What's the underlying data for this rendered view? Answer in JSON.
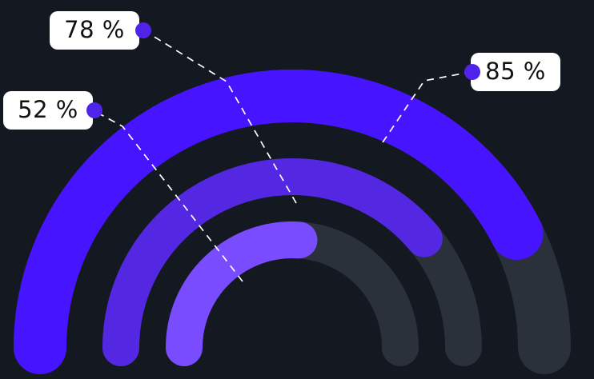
{
  "colors": {
    "background": "#131821",
    "track": "#2a313a",
    "outer_ring": "#4714ff",
    "middle_ring": "#5428e2",
    "inner_ring": "#7a4cff",
    "dot": "#4f23ea",
    "leader_line": "#ffffff",
    "label_bg": "#ffffff",
    "label_text": "#111111"
  },
  "chart_data": {
    "type": "radial-bar",
    "series": [
      {
        "value": 85,
        "label": "85 %",
        "ring": "outer"
      },
      {
        "value": 78,
        "label": "78 %",
        "ring": "middle"
      },
      {
        "value": 52,
        "label": "52 %",
        "ring": "inner"
      }
    ],
    "max": 100,
    "shape": "semicircle"
  }
}
